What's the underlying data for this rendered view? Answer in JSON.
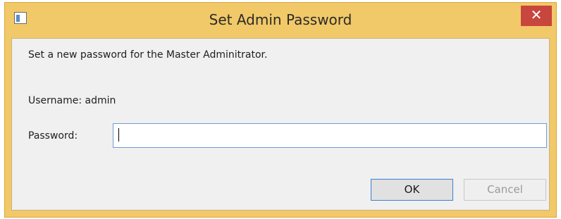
{
  "window": {
    "title": "Set Admin Password",
    "close_glyph": "✕",
    "app_icon": "window-app-icon"
  },
  "dialog": {
    "message": "Set a new password for the Master Adminitrator.",
    "username_line": "Username: admin",
    "password_label": "Password:",
    "password_value": "",
    "ok_label": "OK",
    "cancel_label": "Cancel"
  },
  "colors": {
    "frame": "#f2c968",
    "close": "#c7463d",
    "focus_border": "#3c7fd0"
  }
}
